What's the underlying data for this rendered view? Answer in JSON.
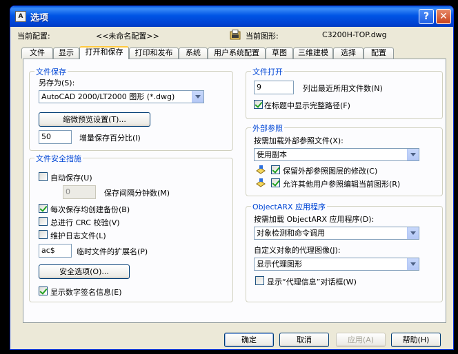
{
  "window": {
    "title": "选项",
    "help_glyph": "?",
    "close_glyph": "✕"
  },
  "profile": {
    "label": "当前配置:",
    "value": "<<未命名配置>>"
  },
  "drawing": {
    "label": "当前图形:",
    "value": "C3200H-TOP.dwg"
  },
  "tabs": [
    "文件",
    "显示",
    "打开和保存",
    "打印和发布",
    "系统",
    "用户系统配置",
    "草图",
    "三维建模",
    "选择",
    "配置"
  ],
  "active_tab": "打开和保存",
  "file_save": {
    "title": "文件保存",
    "save_as_label": "另存为(S):",
    "save_as_value": "AutoCAD 2000/LT2000 图形 (*.dwg)",
    "thumbnail_button": "缩微预览设置(T)...",
    "incremental_value": "50",
    "incremental_label": "增量保存百分比(I)"
  },
  "file_safety": {
    "title": "文件安全措施",
    "autosave_label": "自动保存(U)",
    "autosave_checked": false,
    "autosave_minutes_value": "0",
    "autosave_minutes_label": "保存间隔分钟数(M)",
    "backup_label": "每次保存均创建备份(B)",
    "backup_checked": true,
    "crc_label": "总进行 CRC 校验(V)",
    "crc_checked": false,
    "log_label": "维护日志文件(L)",
    "log_checked": false,
    "temp_ext_value": "ac$",
    "temp_ext_label": "临时文件的扩展名(P)",
    "security_button": "安全选项(O)...",
    "digital_sig_label": "显示数字签名信息(E)",
    "digital_sig_checked": true
  },
  "file_open": {
    "title": "文件打开",
    "recent_value": "9",
    "recent_label": "列出最近所用文件数(N)",
    "full_path_label": "在标题中显示完整路径(F)",
    "full_path_checked": true
  },
  "xref": {
    "title": "外部参照",
    "demand_label": "按需加载外部参照文件(X):",
    "demand_value": "使用副本",
    "retain_label": "保留外部参照图层的修改(C)",
    "retain_checked": true,
    "allow_edit_label": "允许其他用户参照编辑当前图形(R)",
    "allow_edit_checked": true
  },
  "objectarx": {
    "title": "ObjectARX 应用程序",
    "demand_label": "按需加载 ObjectARX 应用程序(D):",
    "demand_value": "对象检测和命令调用",
    "proxy_label": "自定义对象的代理图像(J):",
    "proxy_value": "显示代理图形",
    "proxy_dialog_label": "显示“代理信息”对话框(W)",
    "proxy_dialog_checked": false
  },
  "footer": {
    "ok": "确定",
    "cancel": "取消",
    "apply": "应用(A)",
    "help": "帮助(H)"
  },
  "colors": {
    "title_bar": "#0055e5",
    "group_title": "#0046d5",
    "dialog_bg": "#ece9d8",
    "panel_bg": "#fcfcfe",
    "desktop": "#000000"
  }
}
